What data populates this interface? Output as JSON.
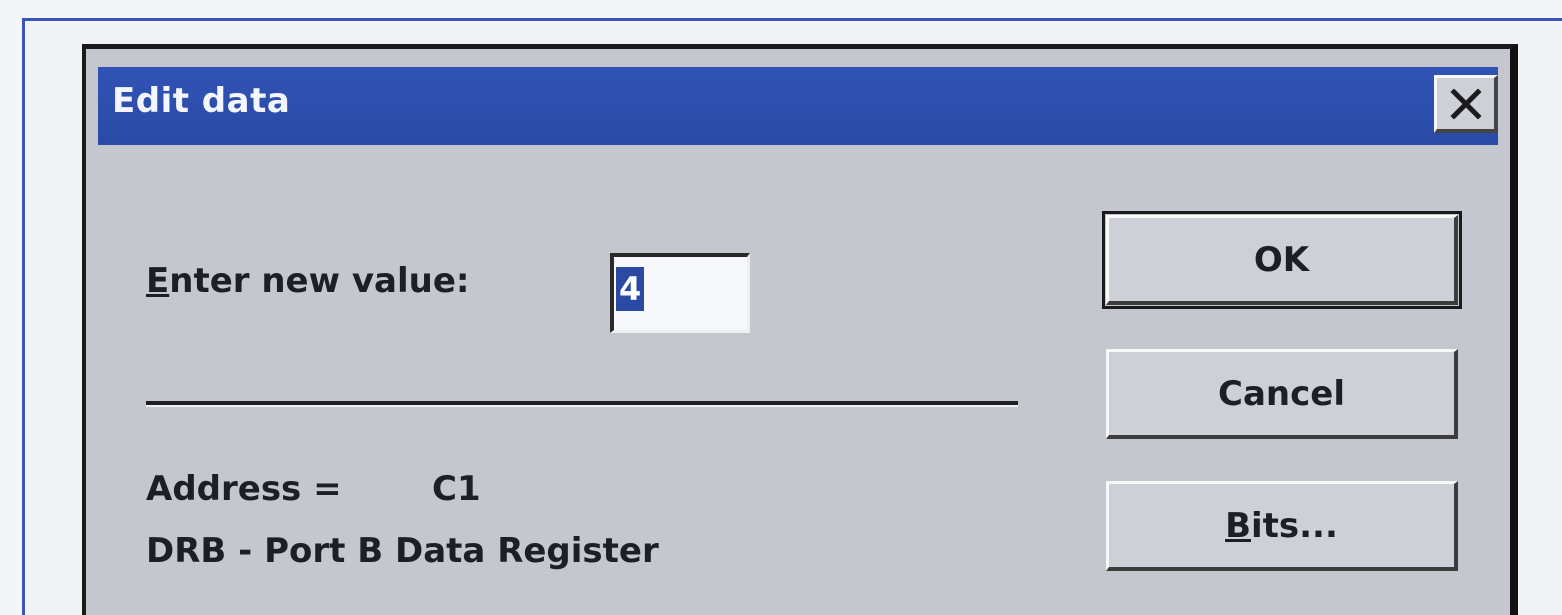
{
  "dialog": {
    "title": "Edit data",
    "prompt": {
      "mnemonic": "E",
      "rest": "nter new value:"
    },
    "input_value": "4",
    "address_label": "Address =",
    "address_value": "C1",
    "register_name": "DRB - Port B Data Register",
    "buttons": {
      "ok": "OK",
      "cancel": "Cancel",
      "bits_mnemonic": "B",
      "bits_rest": "its..."
    },
    "close_icon": "close-icon",
    "colors": {
      "titlebar": "#2a4aa6",
      "face": "#c4c7ce",
      "selection": "#2b4aa4"
    }
  }
}
